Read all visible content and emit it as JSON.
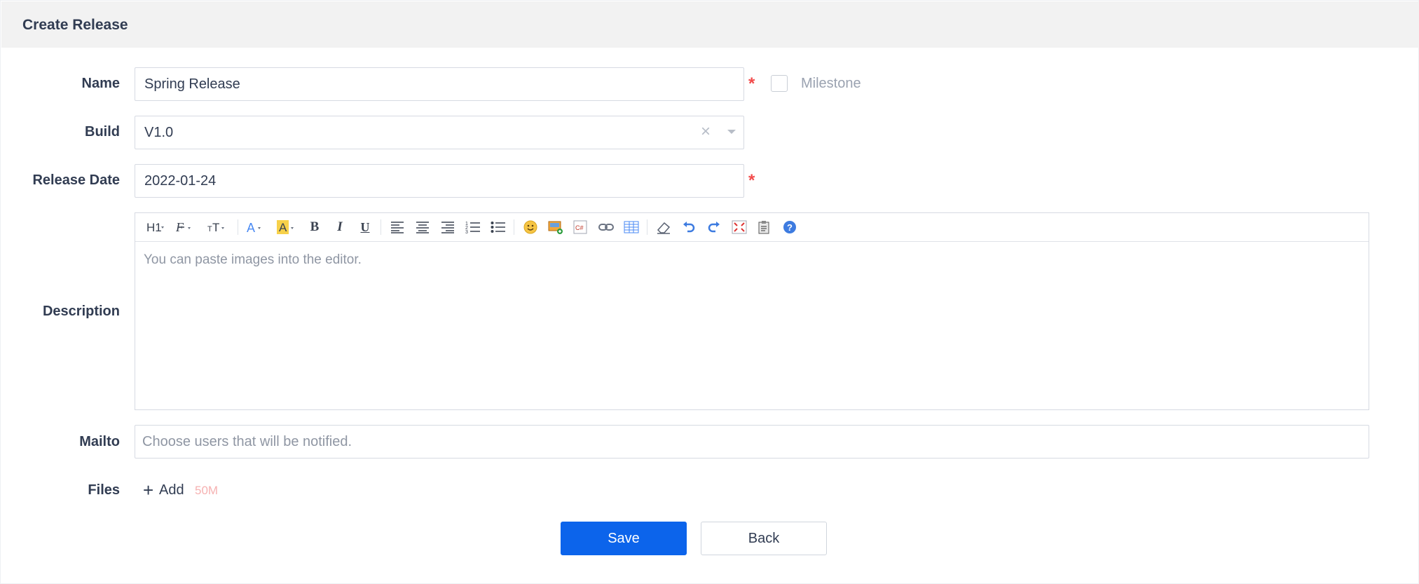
{
  "header": {
    "title": "Create Release"
  },
  "form": {
    "name": {
      "label": "Name",
      "value": "Spring Release",
      "required_mark": "*"
    },
    "milestone": {
      "label": "Milestone",
      "checked": false
    },
    "build": {
      "label": "Build",
      "value": "V1.0",
      "clear_symbol": "×"
    },
    "release_date": {
      "label": "Release Date",
      "value": "2022-01-24",
      "required_mark": "*"
    },
    "description": {
      "label": "Description",
      "placeholder": "You can paste images into the editor.",
      "toolbar": [
        "heading",
        "font-family",
        "font-size",
        "font-color",
        "background-color",
        "bold",
        "italic",
        "underline",
        "align-left",
        "align-center",
        "align-right",
        "ordered-list",
        "unordered-list",
        "emoticons",
        "image",
        "code",
        "link",
        "table",
        "clear-format",
        "undo",
        "redo",
        "fullscreen",
        "paste-word",
        "help"
      ]
    },
    "mailto": {
      "label": "Mailto",
      "placeholder": "Choose users that will be notified."
    },
    "files": {
      "label": "Files",
      "add_label": "Add",
      "size_limit": "50M"
    }
  },
  "actions": {
    "save_label": "Save",
    "back_label": "Back"
  },
  "colors": {
    "primary": "#0c64eb",
    "required": "#f24b4b",
    "header_bg": "#f2f2f2"
  }
}
